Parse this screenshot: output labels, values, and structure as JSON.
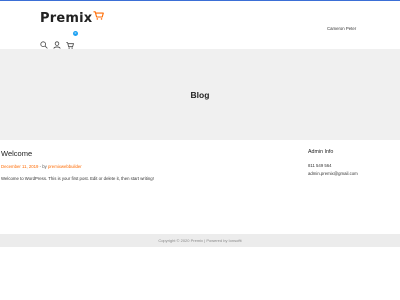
{
  "brand": {
    "name": "Premix",
    "accent": "#ff6a00",
    "cart_icon": "cart-icon"
  },
  "header": {
    "user_name": "Cameron Peter",
    "cart_count": "0"
  },
  "hero": {
    "title": "Blog"
  },
  "post": {
    "title": "Welcome",
    "date": "December 11, 2019",
    "separator": " - by ",
    "author": "premixwebbuilder",
    "excerpt": "Welcome to WordPress. This is your first post. Edit or delete it, then start writing!"
  },
  "widget": {
    "title": "Admin Info",
    "phone": "811 549 564",
    "email": "admin.premix@gmail.com"
  },
  "footer": {
    "text": "Copyright © 2020 Premix | Powered by Ionsoftt"
  },
  "colors": {
    "top_line": "#3b6fd6",
    "badge": "#1da1f2",
    "hero_bg": "#f0f0f0",
    "footer_bg": "#ececec"
  }
}
